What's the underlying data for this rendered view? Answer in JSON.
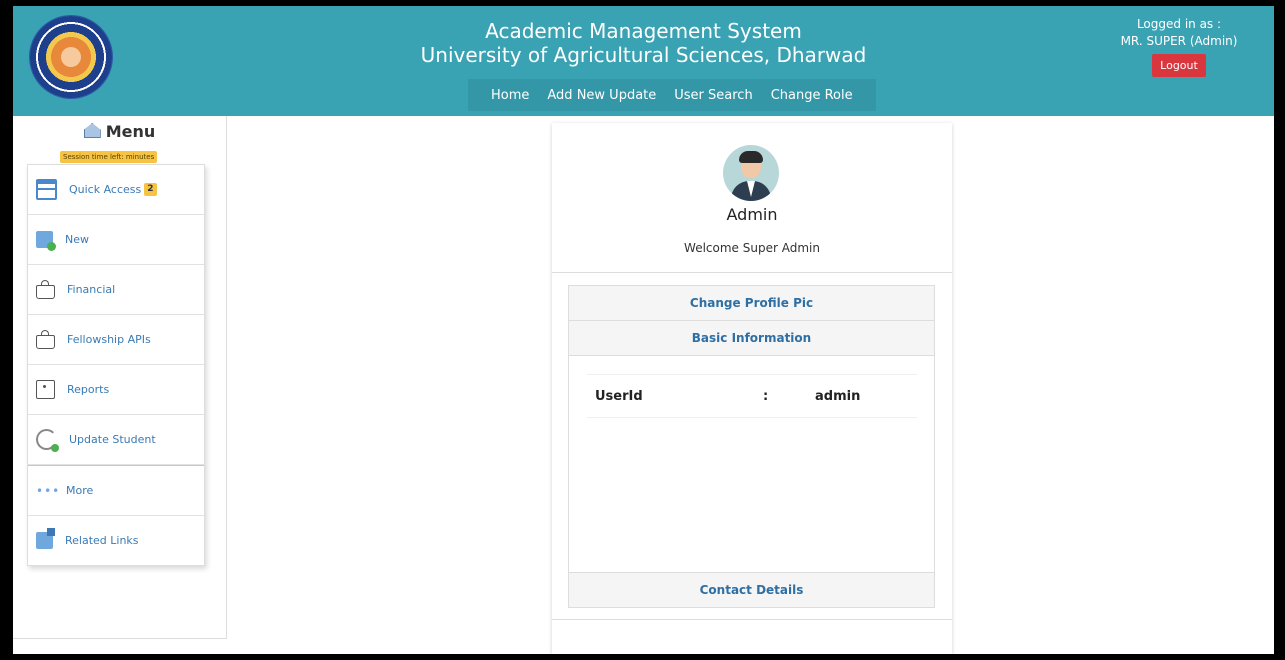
{
  "header": {
    "title_line1": "Academic Management System",
    "title_line2": "University of Agricultural Sciences, Dharwad",
    "nav": [
      "Home",
      "Add New Update",
      "User Search",
      "Change Role"
    ],
    "logged_in_label": "Logged in as :",
    "user": "MR. SUPER (Admin)",
    "logout_label": "Logout",
    "logo_icon": "university-seal-logo"
  },
  "sidebar": {
    "menu_title": "Menu",
    "session_text": "Session time left: minutes",
    "items": [
      {
        "label": "Quick Access",
        "badge": "2",
        "icon": "quick-access-icon"
      },
      {
        "label": "New",
        "icon": "new-document-icon"
      },
      {
        "label": "Financial",
        "icon": "bag-icon"
      },
      {
        "label": "Fellowship APIs",
        "icon": "bag-icon"
      },
      {
        "label": "Reports",
        "icon": "report-icon"
      },
      {
        "label": "Update Student",
        "icon": "update-icon"
      },
      {
        "label": "More",
        "icon": "more-dots-icon"
      },
      {
        "label": "Related Links",
        "icon": "external-link-icon"
      }
    ]
  },
  "profile": {
    "role": "Admin",
    "welcome": "Welcome Super Admin",
    "change_pic_label": "Change Profile Pic",
    "basic_info_label": "Basic Information",
    "userid_key": "UserId",
    "separator": ":",
    "userid_value": "admin",
    "contact_label": "Contact Details"
  },
  "colors": {
    "header_bg": "#3aa3b3",
    "logout_bg": "#d9363e",
    "badge_bg": "#f6c343"
  }
}
